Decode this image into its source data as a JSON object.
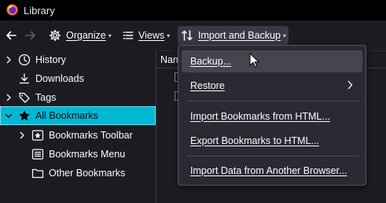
{
  "window": {
    "title": "Library"
  },
  "toolbar": {
    "organize_label": "Organize",
    "views_label": "Views",
    "import_backup_label": "Import and Backup"
  },
  "sidebar": {
    "items": [
      {
        "label": "History",
        "icon": "clock-icon",
        "expanded": false
      },
      {
        "label": "Downloads",
        "icon": "download-icon"
      },
      {
        "label": "Tags",
        "icon": "tag-icon",
        "expanded": false
      },
      {
        "label": "All Bookmarks",
        "icon": "star-icon",
        "expanded": true,
        "selected": true
      },
      {
        "label": "Bookmarks Toolbar",
        "icon": "bookmarks-toolbar-icon",
        "expanded": false
      },
      {
        "label": "Bookmarks Menu",
        "icon": "bookmarks-menu-icon"
      },
      {
        "label": "Other Bookmarks",
        "icon": "folder-icon"
      }
    ]
  },
  "content": {
    "column_name": "Nam"
  },
  "menu": {
    "items": [
      {
        "label": "Backup...",
        "hover": true
      },
      {
        "label": "Restore",
        "submenu": true
      },
      {
        "label": "Import Bookmarks from HTML..."
      },
      {
        "label": "Export Bookmarks to HTML..."
      },
      {
        "label": "Import Data from Another Browser..."
      }
    ]
  },
  "colors": {
    "accent": "#00b8d4",
    "background": "#1c1b22",
    "titlebar": "#000000",
    "menu_background": "#2b2a33"
  }
}
